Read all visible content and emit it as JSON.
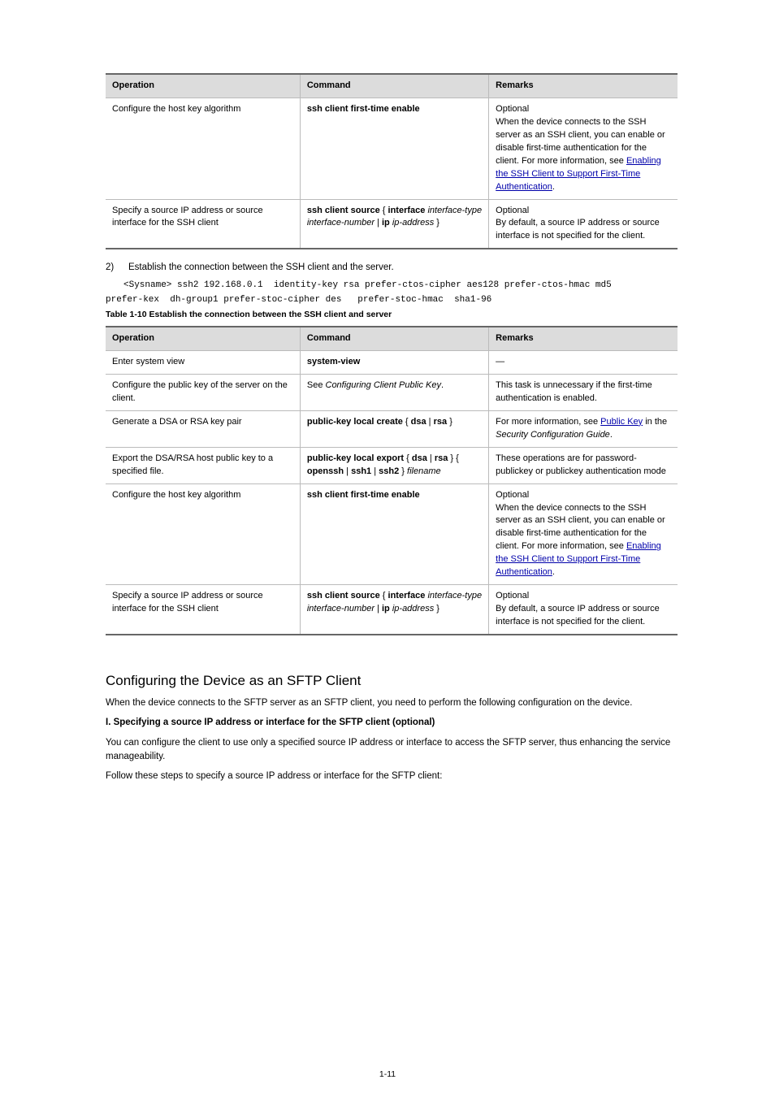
{
  "tables": {
    "headers": {
      "col1": "Operation",
      "col2": "Command",
      "col3": "Remarks"
    },
    "t9": {
      "rows": [
        {
          "op": "Configure the host key algorithm",
          "cmd_line1": "ssh client first-time enable",
          "cmd_prefix": "",
          "remarks": "Optional\nWhen the device connects to the SSH server as an SSH client, you can enable or disable first-time authentication for the client. For more information, see Enabling the SSH Client to Support First-Time Authentication."
        },
        {
          "op": "Specify a source IP address or source interface for the SSH client",
          "cmd_line1": "ssh client source",
          "cmd_prefix": "{ interface interface-type interface-number | ip ip-address }",
          "remarks": "Optional\nBy default, a source IP address or source interface is not specified for the client."
        }
      ]
    },
    "t10": {
      "caption": "Table 1-10 Establish the connection between the SSH client and server",
      "rows": [
        {
          "op": "Enter system view",
          "cmd": "system-view",
          "remarks": "—"
        },
        {
          "op": "Configure the public key of the server on the client.",
          "cmd": "See Configuring Client Public Key.",
          "remarks": "This task is unnecessary if the first-time authentication is enabled."
        },
        {
          "op": "Generate a DSA or RSA key pair",
          "cmd": "public-key local create { dsa | rsa }",
          "remarks": "For more information, see Public Key in the Security Configuration Guide."
        },
        {
          "op": "Export the DSA/RSA host public key to a specified file.",
          "cmd": "public-key local export { dsa | rsa } { openssh | ssh1 | ssh2 } filename",
          "remarks": "These operations are for password-publickey or publickey authentication mode"
        },
        {
          "op": "Configure the host key algorithm",
          "cmd": "ssh client first-time enable",
          "remarks": "Optional\nWhen the device connects to the SSH server as an SSH client, you can enable or disable first-time authentication for the client. For more information, see Enabling the SSH Client to Support First-Time Authentication."
        },
        {
          "op": "Specify a source IP address or source interface for the SSH client",
          "cmd": "ssh client source { interface interface-type interface-number | ip ip-address }",
          "remarks": "Optional\nBy default, a source IP address or source interface is not specified for the client."
        }
      ]
    }
  },
  "steps": {
    "s2": {
      "label": "2)",
      "title": "Establish the connection between the SSH client and the server.",
      "cmd_lead": "<Sysname>",
      "cmd_body": " ssh2 192.168.0.1  identity-key rsa prefer-ctos-cipher aes128 prefer-ctos-hmac md5",
      "cmd_body2": "prefer-kex  dh-group1 prefer-stoc-cipher des   prefer-stoc-hmac  sha1-96"
    }
  },
  "sections": {
    "sftp_title": "Configuring the Device as an SFTP Client",
    "sftp_p1": "When the device connects to the SFTP server as an SFTP client, you need to perform the following configuration on the device.",
    "sftp_sub1": "I. Specifying a source IP address or interface for the SFTP client (optional)",
    "sftp_p2": "You can configure the client to use only a specified source IP address or interface to access the SFTP server, thus enhancing the service manageability.",
    "sftp_p3": "Follow these steps to specify a source IP address or interface for the SFTP client:"
  },
  "links": {
    "enable_first_time": "Enabling the SSH Client to Support First-Time Authentication",
    "public_key": "Public Key"
  },
  "footer": {
    "page_num": "1-11"
  }
}
